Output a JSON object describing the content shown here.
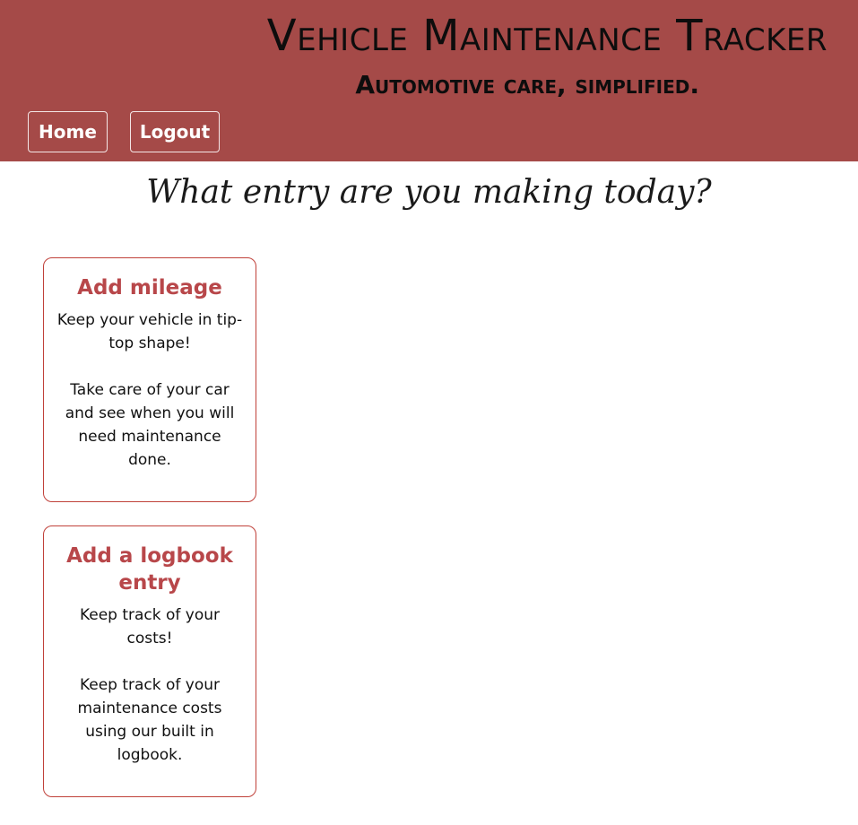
{
  "header": {
    "title": "Vehicle Maintenance Tracker",
    "tagline": "Automotive care, simplified.",
    "background_color": "#a54a48"
  },
  "nav": {
    "home_label": "Home",
    "logout_label": "Logout"
  },
  "main": {
    "prompt": "What entry are you making today?",
    "cards": [
      {
        "title": "Add mileage",
        "line1": "Keep your vehicle in tip-top shape!",
        "line2": "Take care of your car and see when you will need maintenance done."
      },
      {
        "title": "Add a logbook entry",
        "line1": "Keep track of your costs!",
        "line2": "Keep track of your maintenance costs using our built in logbook."
      }
    ]
  },
  "colors": {
    "accent": "#b8474a",
    "card_border": "#c0413a"
  }
}
